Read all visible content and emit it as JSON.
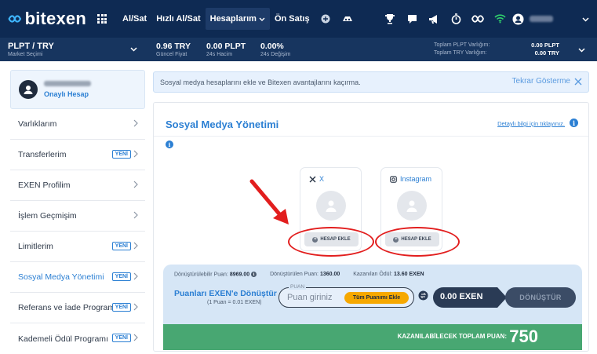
{
  "brand": {
    "name": "bitexen"
  },
  "nav": {
    "items": [
      "Al/Sat",
      "Hızlı Al/Sat",
      "Hesaplarım",
      "Ön Satış"
    ]
  },
  "market": {
    "pair": "PLPT / TRY",
    "pair_sub": "Market Seçimi",
    "stats": [
      {
        "value": "0.96 TRY",
        "label": "Güncel Fiyat"
      },
      {
        "value": "0.00 PLPT",
        "label": "24s Hacim"
      },
      {
        "value": "0.00%",
        "label": "24s Değişim"
      }
    ],
    "assets": [
      {
        "label": "Toplam PLPT Varlığım:",
        "value": "0.00 PLPT"
      },
      {
        "label": "Toplam TRY Varlığım:",
        "value": "0.00 TRY"
      }
    ]
  },
  "sidebar": {
    "verified_label": "Onaylı Hesap",
    "items": [
      {
        "label": "Varlıklarım",
        "badge": ""
      },
      {
        "label": "Transferlerim",
        "badge": "YENİ"
      },
      {
        "label": "EXEN Profilim",
        "badge": ""
      },
      {
        "label": "İşlem Geçmişim",
        "badge": ""
      },
      {
        "label": "Limitlerim",
        "badge": "YENİ"
      },
      {
        "label": "Sosyal Medya Yönetimi",
        "badge": "YENİ"
      },
      {
        "label": "Referans ve İade Programı",
        "badge": "YENİ"
      },
      {
        "label": "Kademeli Ödül Programı",
        "badge": "YENİ"
      }
    ]
  },
  "banner": {
    "text": "Sosyal medya hesaplarını ekle ve Bitexen avantajlarını kaçırma.",
    "dismiss": "Tekrar Gösterme"
  },
  "panel": {
    "title": "Sosyal Medya Yönetimi",
    "detail_link": "Detaylı bilgi için tıklayınız.",
    "cards": [
      {
        "name": "X",
        "icon": "x-logo-icon",
        "button": "HESAP EKLE"
      },
      {
        "name": "Instagram",
        "icon": "instagram-icon",
        "button": "HESAP EKLE"
      }
    ]
  },
  "convert": {
    "stats": [
      {
        "label": "Dönüştürülebilir Puan:",
        "value": "8969.00"
      },
      {
        "label": "Dönüştürülen Puan:",
        "value": "1360.00"
      },
      {
        "label": "Kazanılan Ödül:",
        "value": "13.60 EXEN"
      }
    ],
    "title": "Puanları EXEN'e Dönüştür",
    "rate": "(1 Puan = 0.01 EXEN)",
    "points_legend": "PUAN",
    "points_placeholder": "Puan giriniz",
    "all_points_button": "Tüm Puanımı Ekle",
    "exen_value": "0.00 EXEN",
    "convert_button": "DÖNÜŞTÜR"
  },
  "earn": {
    "label": "KAZANILABİLECEK TOPLAM PUAN:",
    "value": "750"
  },
  "colors": {
    "header": "#0e2a53",
    "accent": "#2b7fd3",
    "earn": "#48a772",
    "highlight": "#e21e1e"
  }
}
